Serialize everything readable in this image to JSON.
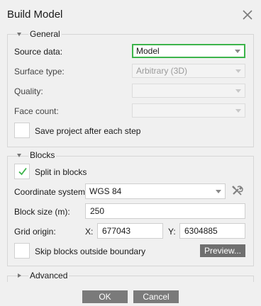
{
  "dialog": {
    "title": "Build Model"
  },
  "general": {
    "header": "General",
    "source_data_label": "Source data:",
    "source_data_value": "Model",
    "surface_type_label": "Surface type:",
    "surface_type_value": "Arbitrary (3D)",
    "quality_label": "Quality:",
    "quality_value": "",
    "face_count_label": "Face count:",
    "face_count_value": "",
    "save_project_label": "Save project after each step",
    "save_project_checked": false
  },
  "blocks": {
    "header": "Blocks",
    "split_label": "Split in blocks",
    "split_checked": true,
    "coord_system_label": "Coordinate system:",
    "coord_system_value": "WGS 84",
    "block_size_label": "Block size (m):",
    "block_size_value": "250",
    "grid_origin_label": "Grid origin:",
    "x_label": "X:",
    "x_value": "677043",
    "y_label": "Y:",
    "y_value": "6304885",
    "skip_label": "Skip blocks outside boundary",
    "skip_checked": false,
    "preview_label": "Preview..."
  },
  "advanced": {
    "header": "Advanced"
  },
  "buttons": {
    "ok": "OK",
    "cancel": "Cancel"
  },
  "colors": {
    "focus_border": "#3cb44b",
    "check_mark": "#3cb44b",
    "button_bg": "#7a7a7a"
  },
  "icons": {
    "close": "close-icon",
    "tools": "tools-icon",
    "checkmark": "checkmark-icon"
  }
}
